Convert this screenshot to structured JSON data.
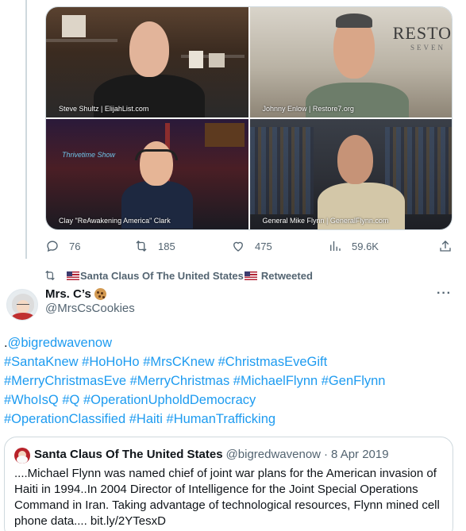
{
  "video": {
    "panels": [
      {
        "caption": "Steve Shultz | ElijahList.com"
      },
      {
        "caption": "Johnny Enlow | Restore7.org",
        "sign_main": "RESTO",
        "sign_sub": "SEVEN"
      },
      {
        "caption": "Clay \"ReAwakening America\" Clark",
        "logo_text": "Thrivetime Show"
      },
      {
        "caption": "General Mike Flynn | GeneralFlynn.com"
      }
    ]
  },
  "actions": {
    "reply_count": "76",
    "retweet_count": "185",
    "like_count": "475",
    "views_count": "59.6K"
  },
  "retweet_header": {
    "text_pre": "",
    "name": "Santa Claus Of The United States",
    "suffix": "Retweeted"
  },
  "tweet": {
    "author_name": "Mrs. C’s",
    "author_handle": "@MrsCsCookies",
    "more": "···",
    "text_lines": [
      ".@bigredwavenow",
      "#SantaKnew #HoHoHo #MrsCKnew #ChristmasEveGift",
      "#MerryChristmasEve #MerryChristmas #MichaelFlynn #GenFlynn",
      "#WhoIsQ #Q #OperationUpholdDemocracy",
      "#OperationClassified #Haiti #HumanTrafficking"
    ],
    "text_prefix_plain": "."
  },
  "quote": {
    "name": "Santa Claus Of The United States",
    "handle": "@bigredwavenow",
    "separator": "·",
    "date": "8 Apr 2019",
    "text": "....Michael Flynn was named chief of joint war plans for the American invasion of Haiti in 1994..In 2004 Director of Intelligence for the Joint Special Operations Command in Iran. Taking advantage of technological resources, Flynn mined cell phone data.... bit.ly/2YTesxD"
  },
  "colors": {
    "link": "#1d9bf0",
    "secondary_text": "#536471",
    "border": "#cfd9de"
  },
  "icons": [
    "reply-icon",
    "retweet-icon",
    "like-icon",
    "views-icon",
    "share-icon",
    "cookie-icon",
    "us-flag-icon"
  ]
}
